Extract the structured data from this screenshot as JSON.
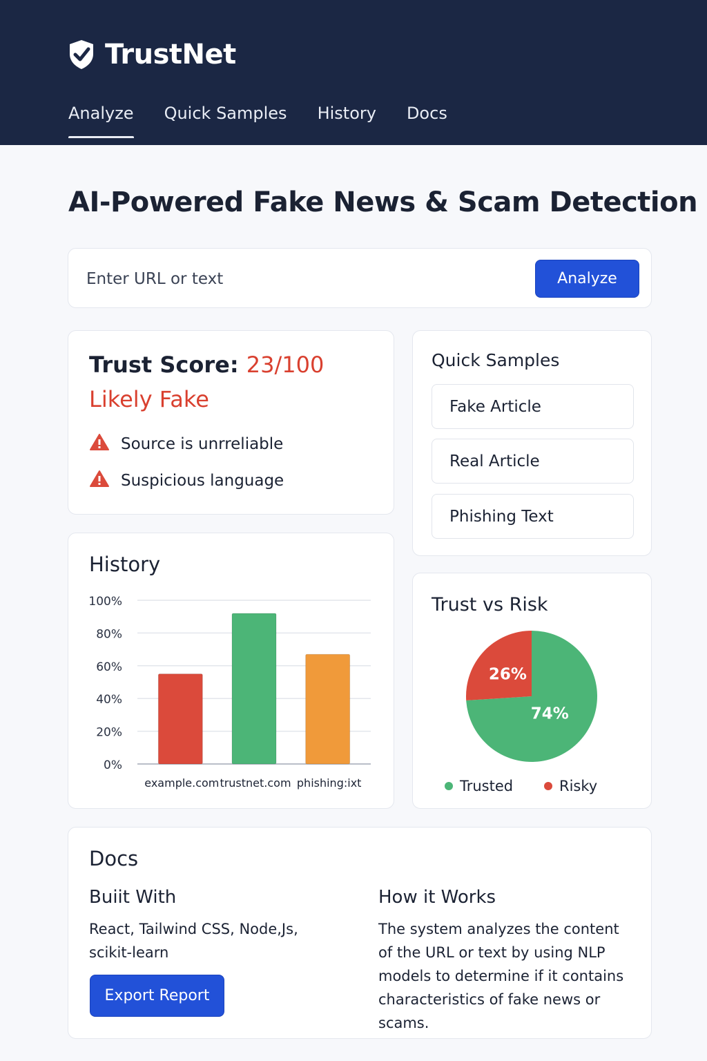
{
  "app": {
    "name": "TrustNet",
    "logo_icon": "shield-check-icon"
  },
  "nav": {
    "items": [
      {
        "label": "Analyze",
        "active": true
      },
      {
        "label": "Quick Samples",
        "active": false
      },
      {
        "label": "History",
        "active": false
      },
      {
        "label": "Docs",
        "active": false
      }
    ]
  },
  "page": {
    "title": "AI-Powered Fake News & Scam Detection"
  },
  "search": {
    "placeholder": "Enter URL or text",
    "value": "",
    "button_label": "Analyze"
  },
  "result": {
    "score_label": "Trust Score:",
    "score_value": "23/100",
    "verdict": "Likely Fake",
    "warnings": [
      {
        "icon": "warning-icon",
        "text": "Source is unrreliable"
      },
      {
        "icon": "warning-icon",
        "text": "Suspicious language"
      }
    ]
  },
  "samples": {
    "title": "Quick Samples",
    "items": [
      "Fake Article",
      "Real Article",
      "Phishing Text"
    ]
  },
  "history": {
    "title": "History"
  },
  "pie": {
    "title": "Trust vs Risk",
    "legend": [
      {
        "label": "Trusted",
        "color": "#4cb577"
      },
      {
        "label": "Risky",
        "color": "#db4a3b"
      }
    ]
  },
  "docs": {
    "title": "Docs",
    "built_with_title": "Buiit With",
    "built_with_text": "React, Tailwind CSS, Node,Js, scikit-learn",
    "how_title": "How it Works",
    "how_text": "The system analyzes the content of the URL or text by using NLP models to determine if it contains characteristics of fake news or scams.",
    "export_label": "Export Report"
  },
  "colors": {
    "header_bg": "#1b2744",
    "primary": "#2251d8",
    "danger": "#d9402f",
    "success": "#4cb577",
    "warning": "#f09a3a"
  },
  "chart_data": [
    {
      "type": "bar",
      "categories": [
        "example.com",
        "trustnet.com",
        "phishing:ixt"
      ],
      "values": [
        55,
        92,
        67
      ],
      "colors": [
        "#db4a3b",
        "#4cb577",
        "#f09a3a"
      ],
      "title": "",
      "xlabel": "",
      "ylabel": "",
      "ylim": [
        0,
        100
      ],
      "yticks": [
        "0%",
        "20%",
        "40%",
        "60%",
        "80%",
        "100%"
      ],
      "grid": true
    },
    {
      "type": "pie",
      "labels": [
        "Trusted",
        "Risky"
      ],
      "values": [
        74,
        26
      ],
      "data_labels": [
        "74%",
        "26%"
      ],
      "colors": [
        "#4cb577",
        "#db4a3b"
      ],
      "legend": "bottom"
    }
  ]
}
